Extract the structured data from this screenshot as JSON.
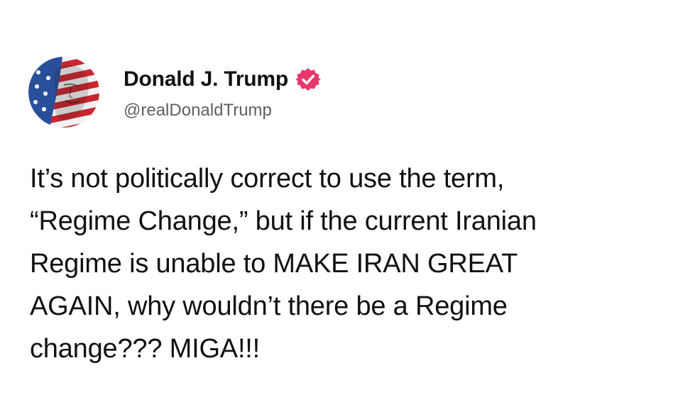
{
  "post": {
    "author": {
      "display_name": "Donald J. Trump",
      "handle": "@realDonaldTrump",
      "verified_color": "#e8386b",
      "avatar_icon": "flag-portrait-avatar"
    },
    "text_lines": [
      "It’s not politically correct to use the term,",
      "“Regime Change,” but if the current Iranian",
      "Regime is unable to MAKE IRAN GREAT",
      "AGAIN, why wouldn’t there be a Regime",
      "change??? MIGA!!!"
    ]
  }
}
